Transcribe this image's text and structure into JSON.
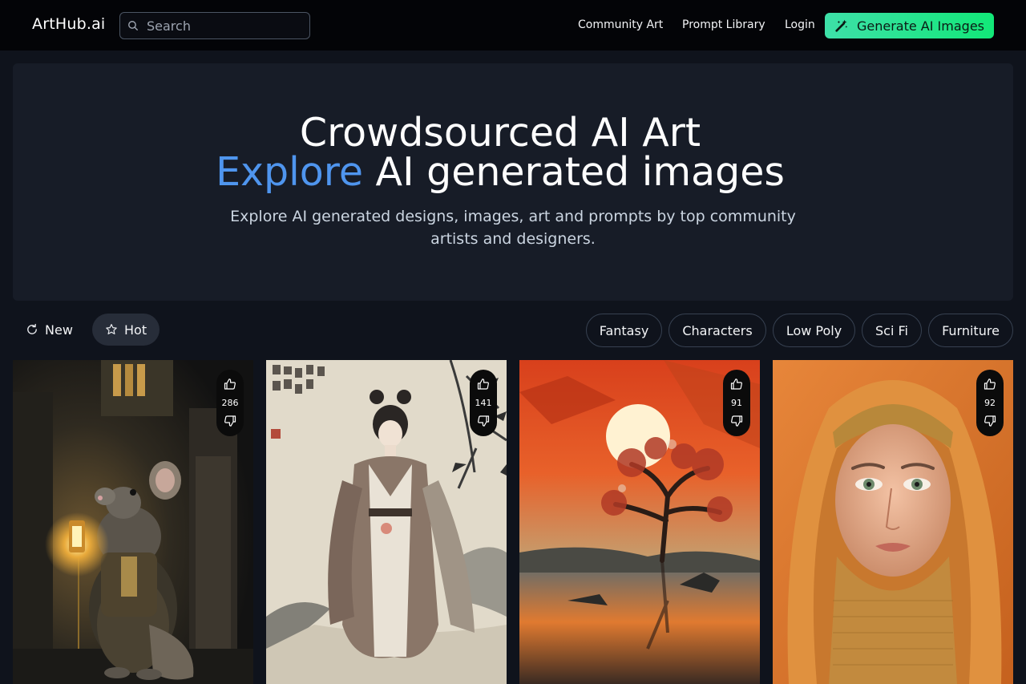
{
  "header": {
    "logo": "ArtHub.ai",
    "search_placeholder": "Search",
    "nav": [
      "Community Art",
      "Prompt Library",
      "Login"
    ],
    "cta_label": "Generate AI Images",
    "cta_color": "#18e57e"
  },
  "hero": {
    "title_line1": "Crowdsourced AI Art",
    "title_accent": "Explore",
    "title_line2_rest": " AI generated images",
    "subtitle": "Explore AI generated designs, images, art and prompts by top community artists and designers.",
    "accent_color": "#4f95ee"
  },
  "sort": {
    "new_label": "New",
    "hot_label": "Hot",
    "active": "Hot"
  },
  "categories": [
    "Fantasy",
    "Characters",
    "Low Poly",
    "Sci Fi",
    "Furniture"
  ],
  "cards": [
    {
      "likes": "286",
      "subject": "mouse in robe holding lantern"
    },
    {
      "likes": "141",
      "subject": "ink painting of girl in hanfu"
    },
    {
      "likes": "91",
      "subject": "tree against orange sunset"
    },
    {
      "likes": "92",
      "subject": "portrait of woman in orange hood"
    }
  ]
}
